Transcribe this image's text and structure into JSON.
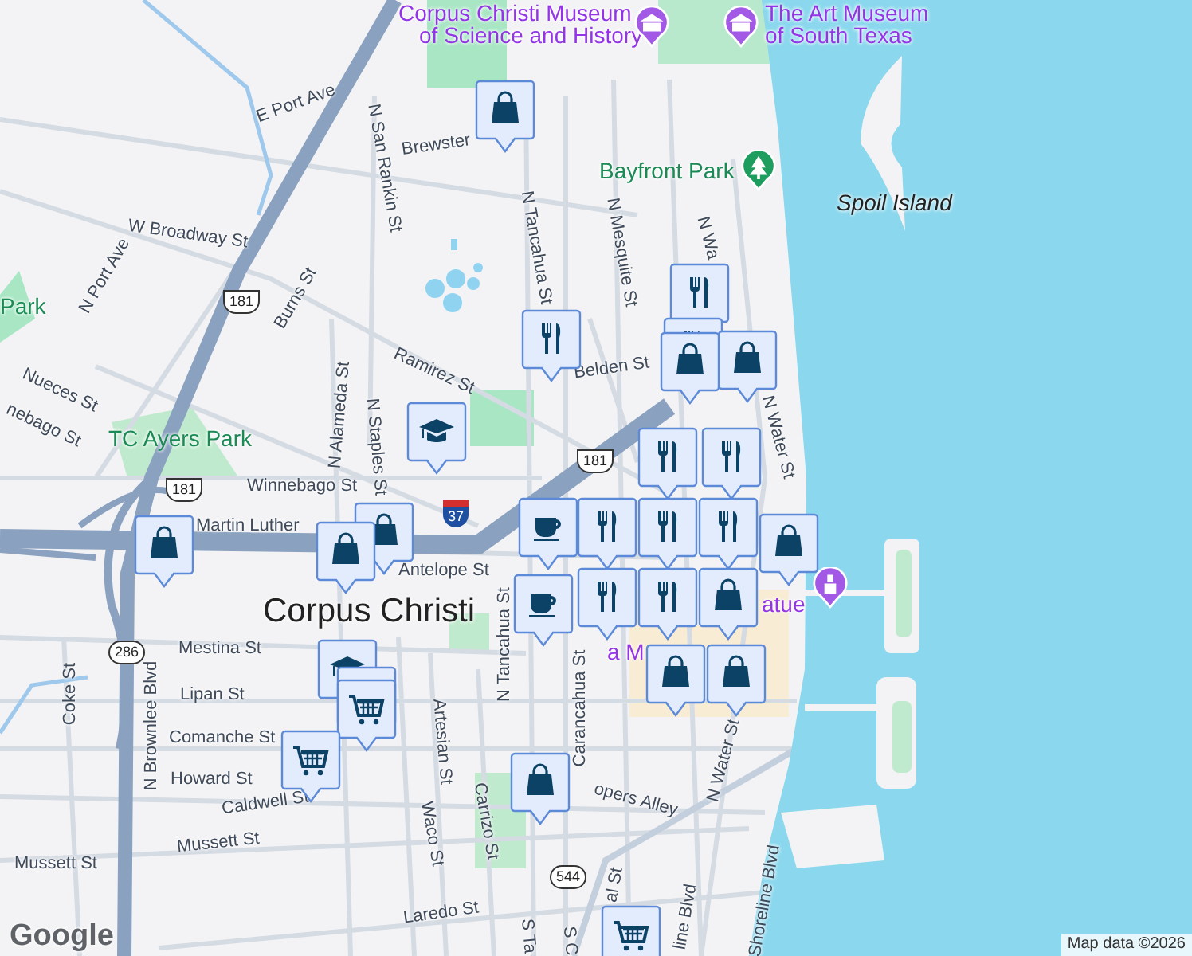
{
  "labels": [
    {
      "text": "Corpus Christi Museum",
      "kind": "poi"
    },
    {
      "text": "of Science and History",
      "kind": "poi"
    },
    {
      "text": "The Art Museum",
      "kind": "poi"
    },
    {
      "text": "of South Texas",
      "kind": "poi"
    },
    {
      "text": "E Port Ave",
      "kind": "street"
    },
    {
      "text": "Brewster",
      "kind": "street"
    },
    {
      "text": "N San Rankin St",
      "kind": "street"
    },
    {
      "text": "W Broadway St",
      "kind": "street"
    },
    {
      "text": "N Port Ave",
      "kind": "street"
    },
    {
      "text": "Burns St",
      "kind": "street"
    },
    {
      "text": "N Tancahua St",
      "kind": "street"
    },
    {
      "text": "Park",
      "kind": "park"
    },
    {
      "text": "Nueces St",
      "kind": "street"
    },
    {
      "text": "nebago St",
      "kind": "street"
    },
    {
      "text": "TC Ayers Park",
      "kind": "park"
    },
    {
      "text": "N Alameda St",
      "kind": "street"
    },
    {
      "text": "N Staples St",
      "kind": "street"
    },
    {
      "text": "Ramirez St",
      "kind": "street"
    },
    {
      "text": "Winnebago St",
      "kind": "street"
    },
    {
      "text": "Martin Luther",
      "kind": "street"
    },
    {
      "text": "Antelope St",
      "kind": "street"
    },
    {
      "text": "Corpus Christi",
      "kind": "city"
    },
    {
      "text": "Mestina St",
      "kind": "street"
    },
    {
      "text": "Lipan St",
      "kind": "street"
    },
    {
      "text": "Comanche St",
      "kind": "street"
    },
    {
      "text": "Howard St",
      "kind": "street"
    },
    {
      "text": "Caldwell St",
      "kind": "street"
    },
    {
      "text": "Mussett St",
      "kind": "street"
    },
    {
      "text": "Mussett St",
      "kind": "street"
    },
    {
      "text": "Coke St",
      "kind": "street"
    },
    {
      "text": "N Brownlee Blvd",
      "kind": "street"
    },
    {
      "text": "Artesian St",
      "kind": "street"
    },
    {
      "text": "Waco St",
      "kind": "street"
    },
    {
      "text": "Carrizo St",
      "kind": "street"
    },
    {
      "text": "Laredo St",
      "kind": "street"
    },
    {
      "text": "S Ta",
      "kind": "street"
    },
    {
      "text": "S C",
      "kind": "street"
    },
    {
      "text": "N Tancahua St",
      "kind": "street"
    },
    {
      "text": "Carancahua St",
      "kind": "street"
    },
    {
      "text": "opers Alley",
      "kind": "street"
    },
    {
      "text": "N Water St",
      "kind": "street"
    },
    {
      "text": "N Water St",
      "kind": "street"
    },
    {
      "text": "N Wa",
      "kind": "street"
    },
    {
      "text": "N Mesquite St",
      "kind": "street"
    },
    {
      "text": "Belden St",
      "kind": "street"
    },
    {
      "text": "Bayfront Park",
      "kind": "park"
    },
    {
      "text": "Spoil Island",
      "kind": "water"
    },
    {
      "text": "Shoreline Blvd",
      "kind": "street"
    },
    {
      "text": "line Blvd",
      "kind": "street"
    },
    {
      "text": "al St",
      "kind": "street"
    },
    {
      "text": "a M",
      "kind": "poi"
    },
    {
      "text": "atue",
      "kind": "poi"
    }
  ],
  "shields": [
    {
      "text": "181",
      "kind": "us"
    },
    {
      "text": "181",
      "kind": "us"
    },
    {
      "text": "181",
      "kind": "us"
    },
    {
      "text": "286",
      "kind": "state"
    },
    {
      "text": "544",
      "kind": "state"
    },
    {
      "text": "37",
      "kind": "interstate"
    }
  ],
  "pins": [
    {
      "kind": "museum"
    },
    {
      "kind": "museum"
    },
    {
      "kind": "park"
    },
    {
      "kind": "statue"
    }
  ],
  "markers": [
    {
      "kind": "shopping"
    },
    {
      "kind": "restaurant"
    },
    {
      "kind": "school"
    },
    {
      "kind": "restaurant"
    },
    {
      "kind": "restaurant"
    },
    {
      "kind": "shopping"
    },
    {
      "kind": "shopping"
    },
    {
      "kind": "shopping"
    },
    {
      "kind": "shopping"
    },
    {
      "kind": "shopping"
    },
    {
      "kind": "restaurant"
    },
    {
      "kind": "restaurant"
    },
    {
      "kind": "restaurant"
    },
    {
      "kind": "restaurant"
    },
    {
      "kind": "cafe"
    },
    {
      "kind": "restaurant"
    },
    {
      "kind": "restaurant"
    },
    {
      "kind": "restaurant"
    },
    {
      "kind": "shopping"
    },
    {
      "kind": "cafe"
    },
    {
      "kind": "shopping"
    },
    {
      "kind": "shopping"
    },
    {
      "kind": "shopping"
    },
    {
      "kind": "school"
    },
    {
      "kind": "grocery"
    },
    {
      "kind": "grocery"
    },
    {
      "kind": "grocery"
    },
    {
      "kind": "shopping"
    },
    {
      "kind": "grocery"
    }
  ],
  "footer": {
    "logo": "Google",
    "attribution": "Map data ©2026"
  }
}
